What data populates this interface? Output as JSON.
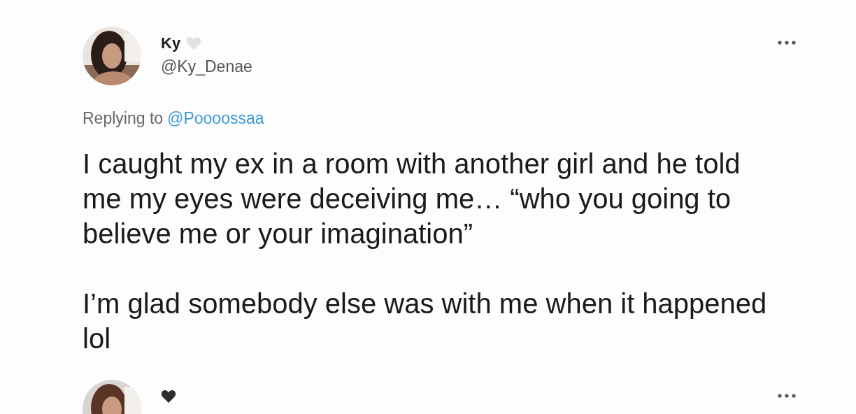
{
  "tweets": [
    {
      "name": "Ky",
      "color": "#e2e2e2",
      "handle": "@Ky_Denae",
      "replying_label": "Replying to",
      "replying_to": "@Poooossaa",
      "paragraphs": [
        "I caught my ex in a room with another girl and he told me my eyes were deceiving me… “who you going to believe me or your imagination”",
        "I’m glad somebody else was with me when it happened lol"
      ]
    },
    {
      "color": "#2e2e2e"
    }
  ]
}
